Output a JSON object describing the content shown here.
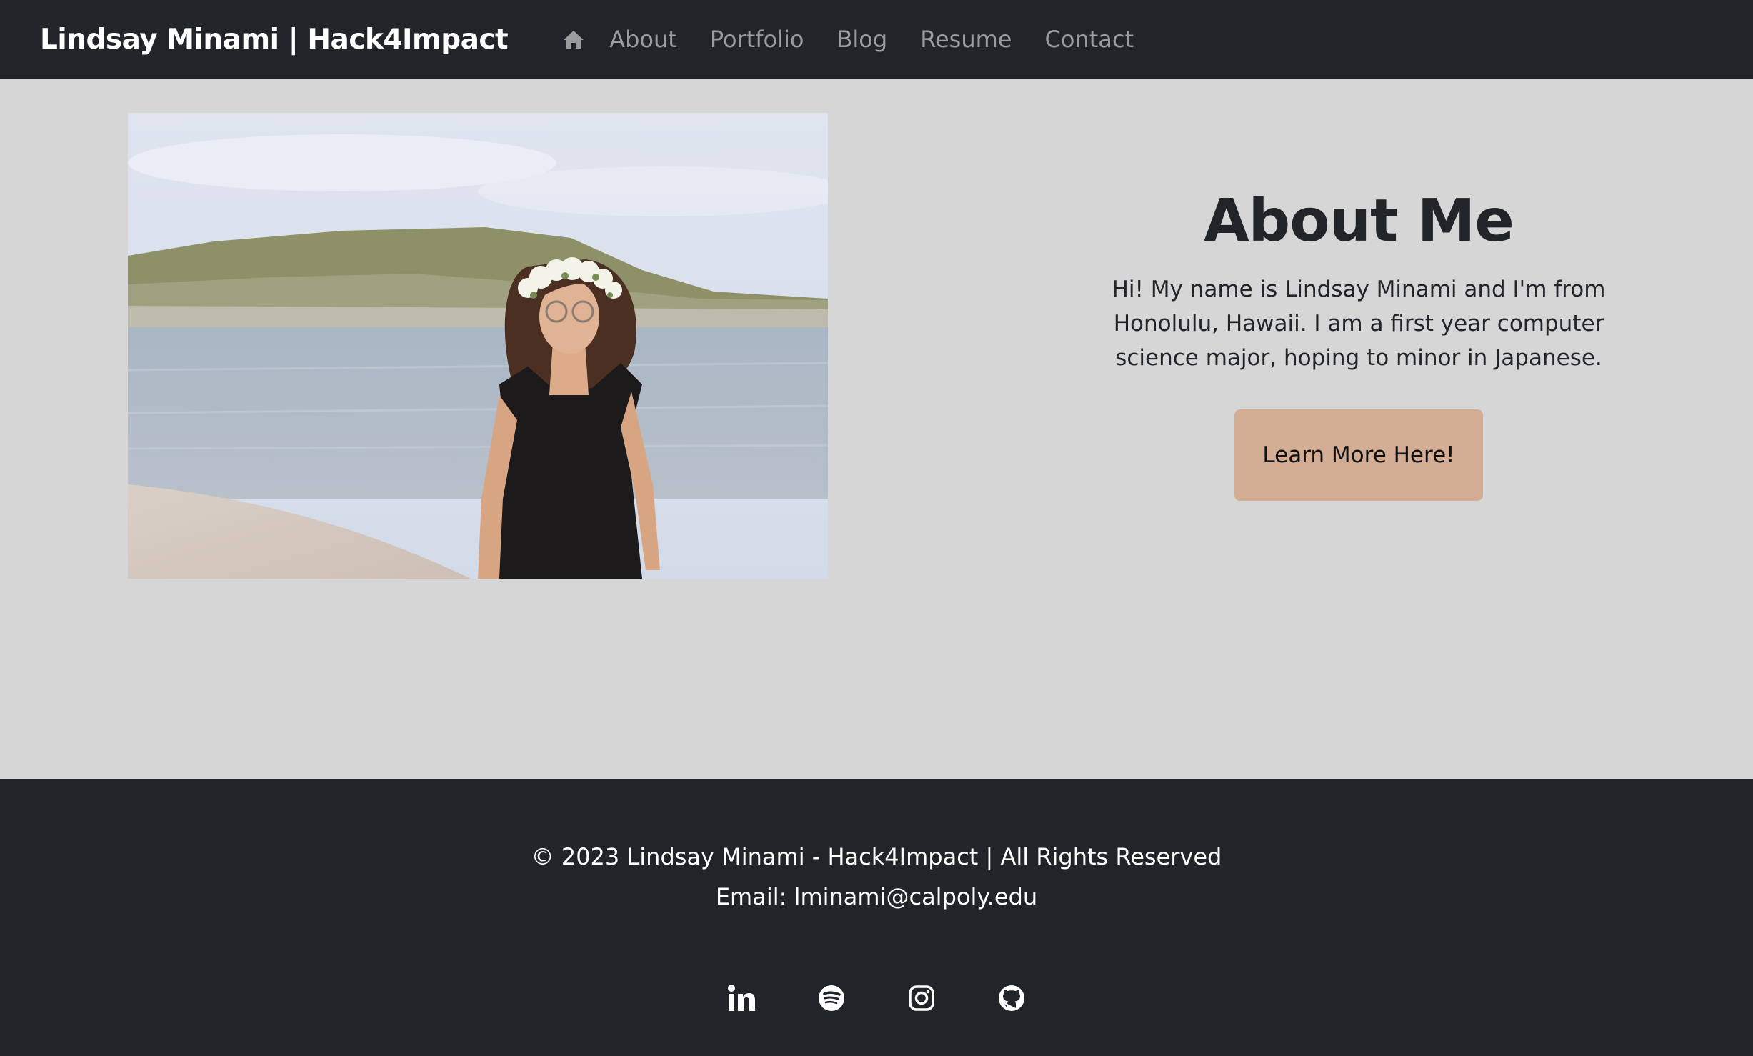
{
  "navbar": {
    "brand": "Lindsay Minami | Hack4Impact",
    "home_icon": "home-icon",
    "links": [
      "About",
      "Portfolio",
      "Blog",
      "Resume",
      "Contact"
    ]
  },
  "about": {
    "title": "About Me",
    "text": "Hi! My name is Lindsay Minami and I'm from Honolulu, Hawaii. I am a first year computer science major, hoping to minor in Japanese.",
    "button_label": "Learn More Here!"
  },
  "footer": {
    "copyright": "© 2023 Lindsay Minami - Hack4Impact | All Rights Reserved",
    "email": "Email: lminami@calpoly.edu",
    "social_icons": [
      "linkedin-icon",
      "spotify-icon",
      "instagram-icon",
      "github-icon"
    ]
  },
  "colors": {
    "navbar_bg": "#212529",
    "page_bg": "#d6d6d6",
    "button_bg": "#d4ae94",
    "footer_bg": "#212529"
  }
}
